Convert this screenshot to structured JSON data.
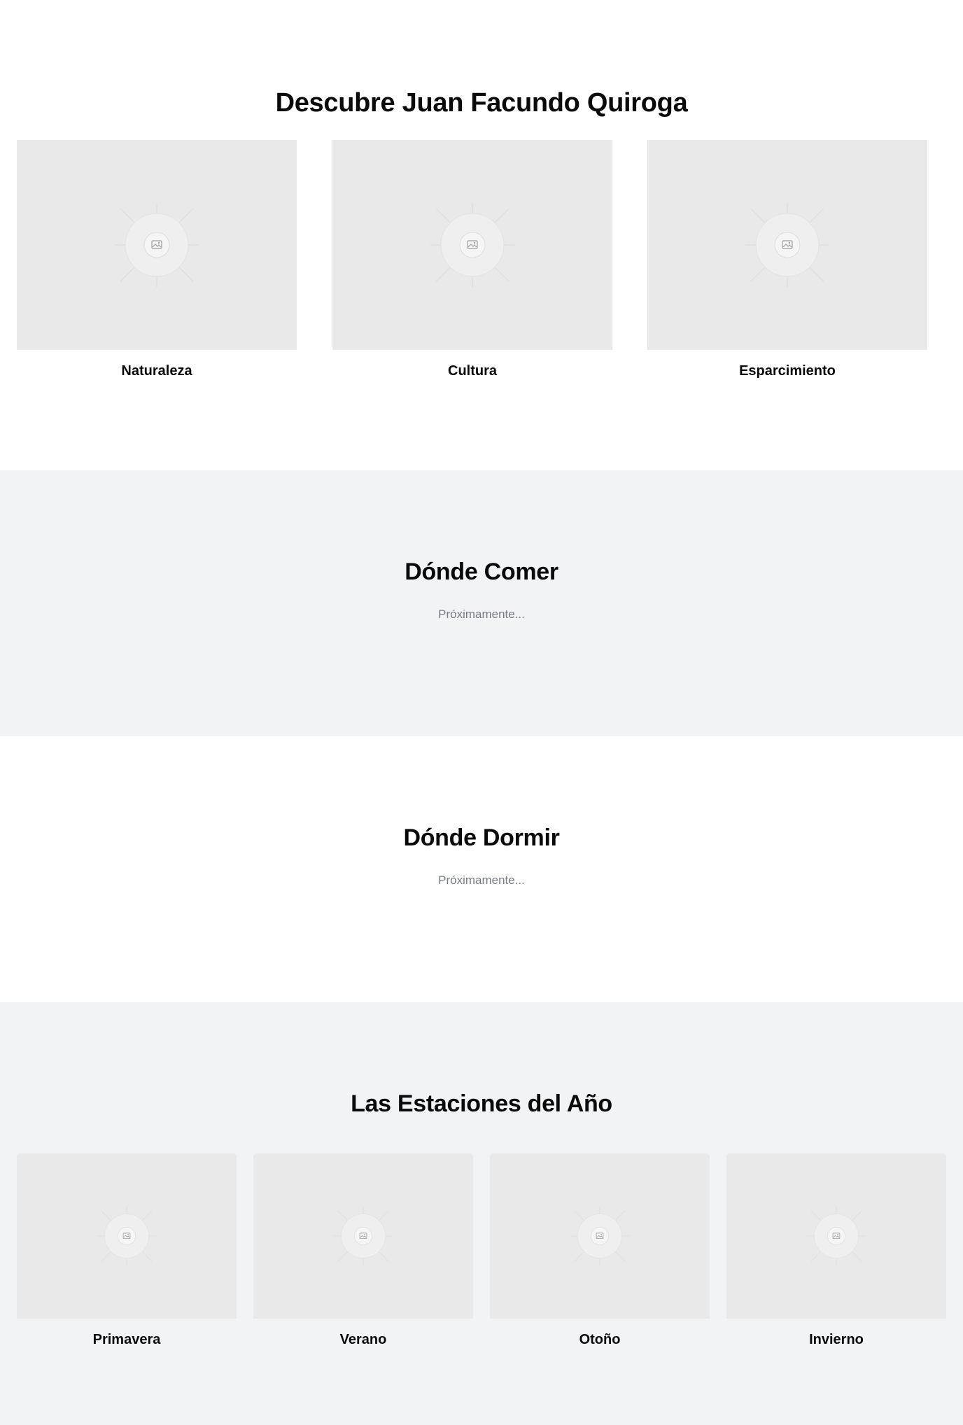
{
  "discover": {
    "title": "Descubre Juan Facundo Quiroga",
    "cards": [
      {
        "label": "Naturaleza",
        "icon": "image-placeholder-icon"
      },
      {
        "label": "Cultura",
        "icon": "image-placeholder-icon"
      },
      {
        "label": "Esparcimiento",
        "icon": "image-placeholder-icon"
      }
    ]
  },
  "where_to_eat": {
    "title": "Dónde Comer",
    "status": "Próximamente..."
  },
  "where_to_sleep": {
    "title": "Dónde Dormir",
    "status": "Próximamente..."
  },
  "seasons": {
    "title": "Las Estaciones del Año",
    "cards": [
      {
        "label": "Primavera",
        "icon": "image-placeholder-icon"
      },
      {
        "label": "Verano",
        "icon": "image-placeholder-icon"
      },
      {
        "label": "Otoño",
        "icon": "image-placeholder-icon"
      },
      {
        "label": "Invierno",
        "icon": "image-placeholder-icon"
      }
    ]
  },
  "colors": {
    "alt_section_bg": "#f2f3f5",
    "placeholder_bg": "#e9e9e9",
    "muted_text": "#767c86"
  }
}
